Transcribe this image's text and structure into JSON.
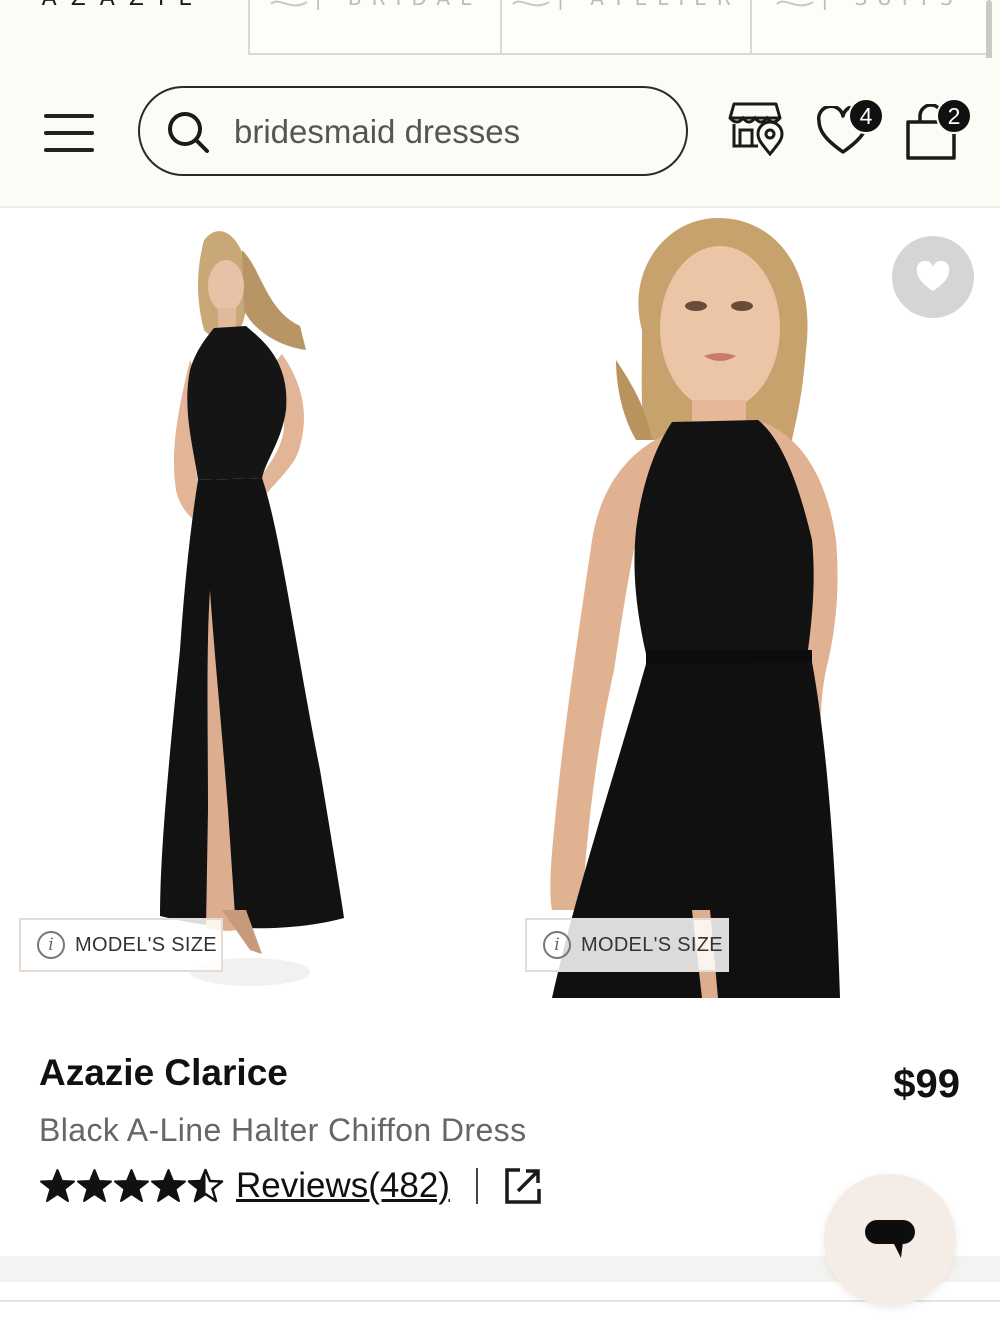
{
  "brand_tabs": [
    {
      "label": "AZAZIE"
    },
    {
      "label": "| BRIDAL"
    },
    {
      "label": "| ATELIER"
    },
    {
      "label": "| SUITS"
    }
  ],
  "header": {
    "search_value": "bridesmaid dresses",
    "wishlist_count": "4",
    "cart_count": "2"
  },
  "gallery": {
    "model_size_label_1": "MODEL'S SIZE",
    "model_size_label_2": "MODEL'S SIZE",
    "info_glyph": "i"
  },
  "product": {
    "title": "Azazie Clarice",
    "subtitle": "Black A-Line Halter Chiffon Dress",
    "price": "$99",
    "rating": 4.5,
    "reviews_label": "Reviews(482)"
  },
  "colors": {
    "header_bg": "#fcfcf7",
    "text": "#111111",
    "subtext": "#666666",
    "chat_bg": "#f5ece6"
  },
  "icons": [
    "menu-icon",
    "search-icon",
    "store-locator-icon",
    "heart-icon",
    "bag-icon",
    "favorite-heart-icon",
    "info-icon",
    "star-icon",
    "half-star-icon",
    "share-icon",
    "chat-icon"
  ]
}
